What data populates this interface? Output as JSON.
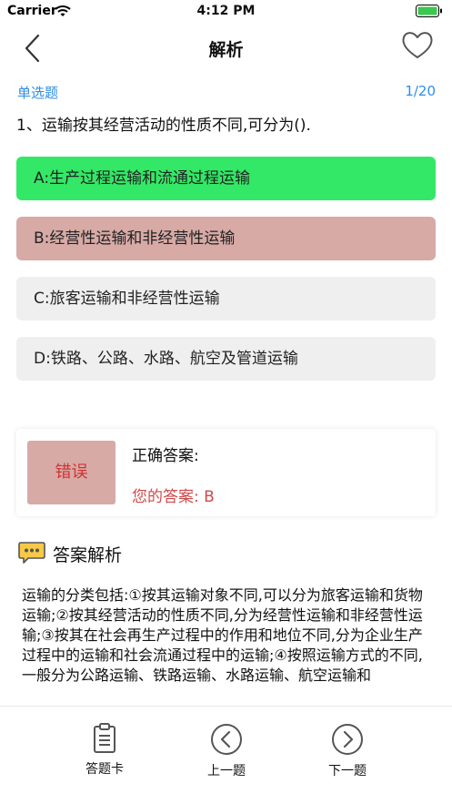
{
  "status_bar": {
    "carrier": "Carrier",
    "time": "4:12 PM"
  },
  "nav": {
    "title": "解析",
    "back_icon": "chevron-left-icon",
    "favorite_icon": "heart-outline-icon"
  },
  "question": {
    "type": "单选题",
    "progress": "1/20",
    "text": "1、运输按其经营活动的性质不同,可分为().",
    "options": [
      {
        "label": "A:生产过程运输和流通过程运输",
        "state": "correct",
        "color": "#33e866"
      },
      {
        "label": "B:经营性运输和非经营性运输",
        "state": "selected-wrong",
        "color": "#d7aaa6"
      },
      {
        "label": "C:旅客运输和非经营性运输",
        "state": "normal",
        "color": "#efefef"
      },
      {
        "label": "D:铁路、公路、水路、航空及管道运输",
        "state": "normal",
        "color": "#efefef"
      }
    ]
  },
  "result": {
    "badge": "错误",
    "correct_answer_label": "正确答案:",
    "your_answer_label": "您的答案:  B"
  },
  "analysis": {
    "heading": "答案解析",
    "icon": "chat-bubble-icon",
    "text": "运输的分类包括:①按其运输对象不同,可以分为旅客运输和货物运输;②按其经营活动的性质不同,分为经营性运输和非经营性运输;③按其在社会再生产过程中的作用和地位不同,分为企业生产过程中的运输和社会流通过程中的运输;④按照运输方式的不同,一般分为公路运输、铁路运输、水路运输、航空运输和"
  },
  "tabs": [
    {
      "label": "答题卡",
      "icon": "clipboard-icon"
    },
    {
      "label": "上一题",
      "icon": "circle-chevron-left-icon"
    },
    {
      "label": "下一题",
      "icon": "circle-chevron-right-icon"
    }
  ],
  "colors": {
    "accent_blue": "#2e8de6",
    "correct_green": "#33e866",
    "wrong_bg": "#d7aaa6",
    "wrong_text": "#cf3434"
  }
}
